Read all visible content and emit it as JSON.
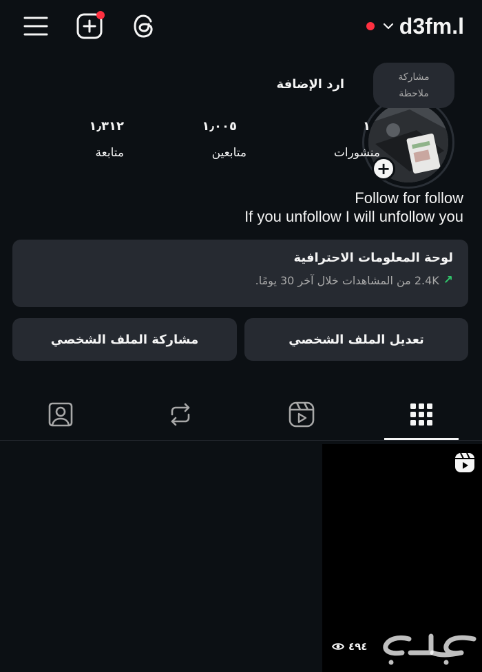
{
  "header": {
    "username": "d3fm.l",
    "icons": [
      "menu-icon",
      "add-post-icon",
      "threads-icon",
      "chevron-down-icon"
    ],
    "colors": {
      "notification": "#ff3040",
      "background": "#0c1014",
      "card": "#262a31"
    }
  },
  "profile": {
    "note": "مشاركة\nملاحظة",
    "display_name": "ارد الإضافة",
    "stats": [
      {
        "value": "١",
        "label": "منشورات"
      },
      {
        "value": "١٫٠٠٥",
        "label": "متابعين"
      },
      {
        "value": "١٫٣١٢",
        "label": "متابعة"
      }
    ],
    "bio": [
      "Follow for follow",
      "If you unfollow I will unfollow you"
    ]
  },
  "dashboard": {
    "title": "لوحة المعلومات الاحترافية",
    "views": "2.4K من المشاهدات خلال آخر 30 يومًا.",
    "trend_color": "#30c46a"
  },
  "actions": {
    "edit": "تعديل الملف الشخصي",
    "share": "مشاركة الملف الشخصي"
  },
  "tabs": [
    {
      "icon": "grid-icon",
      "active": true
    },
    {
      "icon": "reels-icon",
      "active": false
    },
    {
      "icon": "reposts-icon",
      "active": false
    },
    {
      "icon": "tagged-icon",
      "active": false
    }
  ],
  "posts": [
    {
      "type": "reel",
      "views": "٤٩٤"
    }
  ],
  "watermark": "حراج"
}
